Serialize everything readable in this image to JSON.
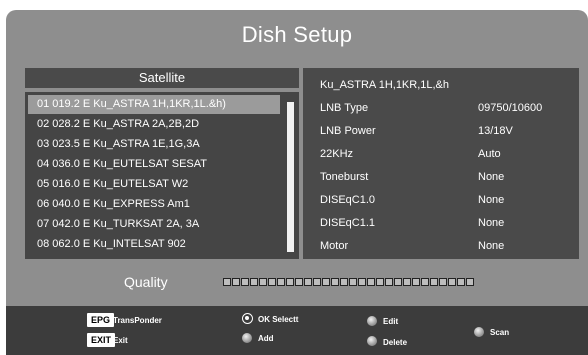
{
  "title": "Dish Setup",
  "satellite": {
    "header": "Satellite",
    "items": [
      "01 019.2 E Ku_ASTRA 1H,1KR,1L.&h)",
      "02 028.2 E Ku_ASTRA 2A,2B,2D",
      "03 023.5 E Ku_ASTRA 1E,1G,3A",
      "04 036.0 E Ku_EUTELSAT SESAT",
      "05 016.0 E Ku_EUTELSAT W2",
      "06 040.0 E Ku_EXPRESS Am1",
      "07 042.0 E Ku_TURKSAT 2A, 3A",
      "08 062.0 E Ku_INTELSAT 902"
    ],
    "selected_index": 0
  },
  "info": {
    "title": "Ku_ASTRA 1H,1KR,1L,&h",
    "rows": [
      {
        "label": "LNB Type",
        "value": "09750/10600"
      },
      {
        "label": "LNB Power",
        "value": "13/18V"
      },
      {
        "label": "22KHz",
        "value": "Auto"
      },
      {
        "label": "Toneburst",
        "value": "None"
      },
      {
        "label": "DISEqC1.0",
        "value": "None"
      },
      {
        "label": "DISEqC1.1",
        "value": "None"
      },
      {
        "label": "Motor",
        "value": "None"
      }
    ]
  },
  "quality": {
    "label": "Quality",
    "segments": 28,
    "level": 0
  },
  "help": {
    "epg_key": "EPG",
    "epg_text": "TransPonder",
    "exit_key": "EXIT",
    "exit_text": "Exit",
    "ok_text": "OK Selectt",
    "add_text": "Add",
    "edit_text": "Edit",
    "delete_text": "Delete",
    "scan_text": "Scan"
  },
  "colors": {
    "background": "#8e8e8e",
    "panel": "#4a4a4a",
    "selection": "#9b9b9b",
    "help_bar": "#3c3c3c"
  }
}
